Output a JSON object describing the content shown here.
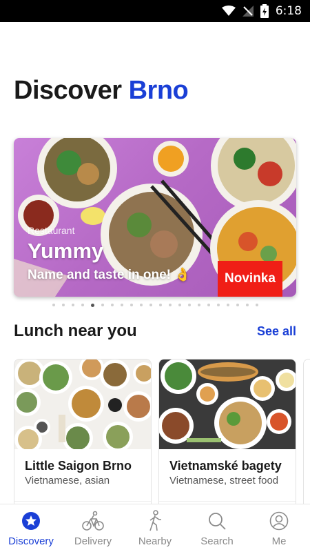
{
  "status_bar": {
    "time": "6:18"
  },
  "header": {
    "title_prefix": "Discover",
    "city": "Brno"
  },
  "hero": {
    "overline": "Restaurant",
    "title": "Yummy",
    "subtitle": "Name and taste in one! 👌",
    "badge": "Novinka",
    "slide_count": 22,
    "active_slide": 5
  },
  "section": {
    "title": "Lunch near you",
    "see_all": "See all"
  },
  "restaurants": [
    {
      "name": "Little Saigon Brno",
      "cuisine": "Vietnamese, asian"
    },
    {
      "name": "Vietnamské bagety",
      "cuisine": "Vietnamese, street food"
    }
  ],
  "tabs": [
    {
      "label": "Discovery",
      "icon": "star-badge-icon",
      "active": true
    },
    {
      "label": "Delivery",
      "icon": "bicycle-icon",
      "active": false
    },
    {
      "label": "Nearby",
      "icon": "walking-person-icon",
      "active": false
    },
    {
      "label": "Search",
      "icon": "search-icon",
      "active": false
    },
    {
      "label": "Me",
      "icon": "user-icon",
      "active": false
    }
  ],
  "colors": {
    "accent": "#1a3fd6",
    "badge": "#f01e16",
    "hero_background": "#b66ac6"
  }
}
